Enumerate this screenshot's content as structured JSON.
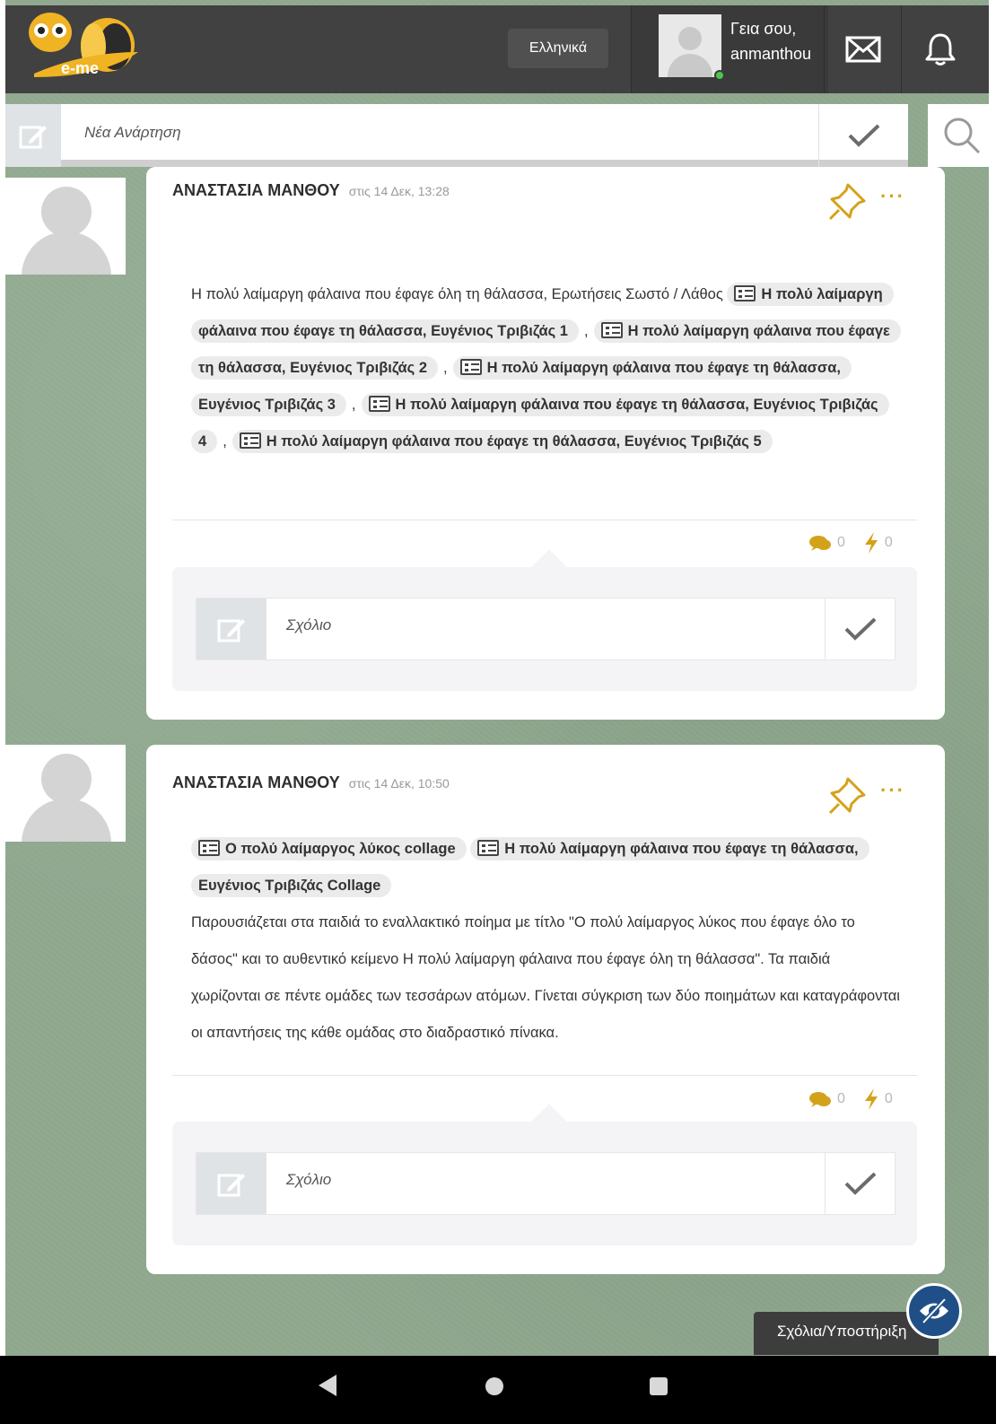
{
  "header": {
    "logo_text": "e-me",
    "language_label": "Ελληνικά",
    "greeting_line1": "Γεια σου,",
    "greeting_line2": "anmanthou"
  },
  "new_post": {
    "placeholder": "Νέα Ανάρτηση"
  },
  "posts": [
    {
      "author": "ΑΝΑΣΤΑΣΙΑ ΜΑΝΘΟΥ",
      "time": "στις 14 Δεκ, 13:28",
      "intro_text": "Η πολύ λαίμαργη φάλαινα που έφαγε όλη τη θάλασσα, Ερωτήσεις Σωστό / Λάθος",
      "attachments": [
        "Η πολύ λαίμαργη φάλαινα που έφαγε τη θάλασσα, Ευγένιος Τριβιζάς 1",
        "Η πολύ λαίμαργη φάλαινα που έφαγε τη θάλασσα, Ευγένιος Τριβιζάς 2",
        "Η πολύ λαίμαργη φάλαινα που έφαγε τη θάλασσα, Ευγένιος Τριβιζάς 3",
        "Η πολύ λαίμαργη φάλαινα που έφαγε τη θάλασσα, Ευγένιος Τριβιζάς 4",
        "Η πολύ λαίμαργη φάλαινα που έφαγε τη θάλασσα, Ευγένιος Τριβιζάς 5"
      ],
      "separator": ",",
      "comments_count": "0",
      "likes_count": "0",
      "comment_placeholder": "Σχόλιο"
    },
    {
      "author": "ΑΝΑΣΤΑΣΙΑ ΜΑΝΘΟΥ",
      "time": "στις 14 Δεκ, 10:50",
      "attachments": [
        "Ο πολύ λαίμαργος λύκος collage",
        "Η πολύ λαίμαργη φάλαινα που έφαγε τη θάλασσα, Ευγένιος Τριβιζάς Collage"
      ],
      "body_text": "Παρουσιάζεται στα παιδιά το εναλλακτικό ποίημα με τίτλο \"Ο πολύ λαίμαργος λύκος που έφαγε όλο το δάσος\" και το αυθεντικό κείμενο Η πολύ λαίμαργη φάλαινα που έφαγε όλη τη θάλασσα\". Τα παιδιά χωρίζονται σε πέντε ομάδες των τεσσάρων ατόμων. Γίνεται σύγκριση των δύο ποιημάτων και καταγράφονται οι απαντήσεις της κάθε ομάδας στο διαδραστικό πίνακα.",
      "comments_count": "0",
      "likes_count": "0",
      "comment_placeholder": "Σχόλιο"
    }
  ],
  "feedback": {
    "label": "Σχόλια/Υποστήριξη"
  },
  "icons": {
    "mail": "mail-icon",
    "bell": "bell-icon",
    "search": "search-icon",
    "edit": "edit-icon",
    "check": "check-icon",
    "pin": "pin-icon",
    "more": "more-icon",
    "comment": "comment-icon",
    "bolt": "bolt-icon",
    "list": "list-icon",
    "eye_off": "eye-off-icon"
  },
  "colors": {
    "accent": "#d4a21a",
    "header_bg": "#414141",
    "page_bg": "#8ea78d",
    "online": "#4cc74c",
    "feedback_button": "#1f4f86"
  }
}
